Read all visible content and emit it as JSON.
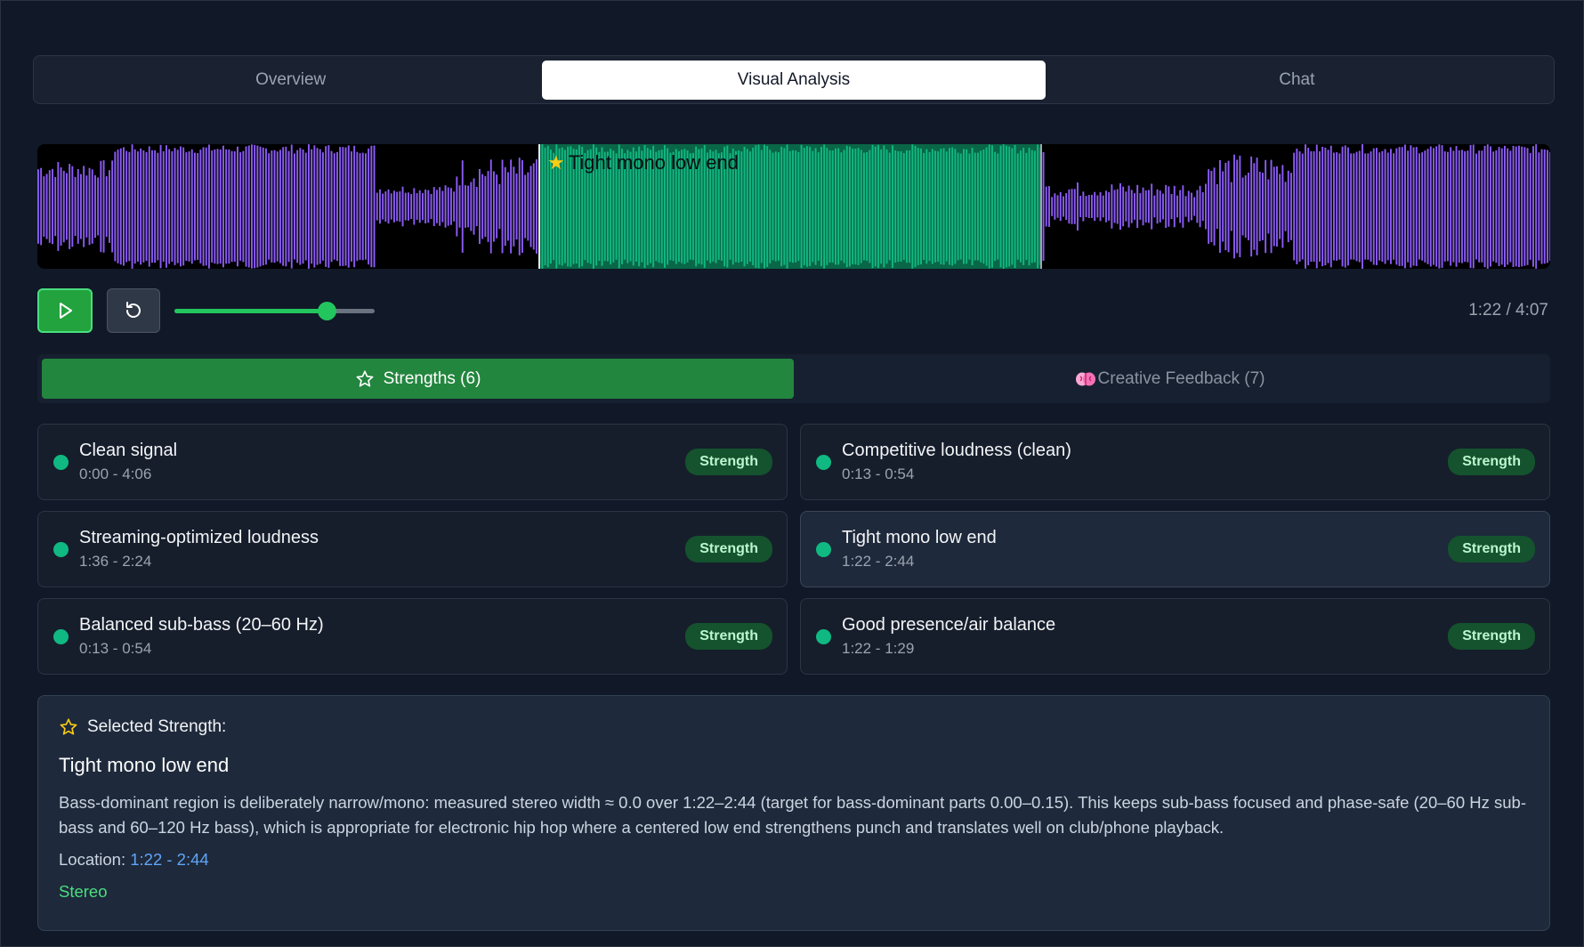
{
  "tabs": [
    {
      "label": "Overview",
      "active": false
    },
    {
      "label": "Visual Analysis",
      "active": true
    },
    {
      "label": "Chat",
      "active": false
    }
  ],
  "waveform": {
    "region_label": "Tight mono low end",
    "region_icon": "star-icon",
    "wave_color": "#8b5cf6",
    "region_color": "#10b981"
  },
  "player": {
    "play_icon": "play-icon",
    "reset_icon": "reset-icon",
    "progress_fraction": 0.76,
    "time": "1:22 / 4:07"
  },
  "subtabs": [
    {
      "label": "Strengths (6)",
      "icon": "star-outline-icon",
      "active": true
    },
    {
      "label": "Creative Feedback (7)",
      "icon": "brain-icon",
      "active": false
    }
  ],
  "items": [
    {
      "title": "Clean signal",
      "time": "0:00 - 4:06",
      "badge": "Strength"
    },
    {
      "title": "Competitive loudness (clean)",
      "time": "0:13 - 0:54",
      "badge": "Strength"
    },
    {
      "title": "Streaming-optimized loudness",
      "time": "1:36 - 2:24",
      "badge": "Strength"
    },
    {
      "title": "Tight mono low end",
      "time": "1:22 - 2:44",
      "badge": "Strength"
    },
    {
      "title": "Balanced sub-bass (20–60 Hz)",
      "time": "0:13 - 0:54",
      "badge": "Strength"
    },
    {
      "title": "Good presence/air balance",
      "time": "1:22 - 1:29",
      "badge": "Strength"
    }
  ],
  "detail": {
    "heading": "Selected Strength:",
    "title": "Tight mono low end",
    "description": "Bass-dominant region is deliberately narrow/mono: measured stereo width ≈ 0.0 over 1:22–2:44 (target for bass-dominant parts 0.00–0.15). This keeps sub-bass focused and phase-safe (20–60 Hz sub-bass and 60–120 Hz bass), which is appropriate for electronic hip hop where a centered low end strengthens punch and translates well on club/phone playback.",
    "location_label": "Location:",
    "location_value": "1:22 - 2:44",
    "tag": "Stereo"
  }
}
